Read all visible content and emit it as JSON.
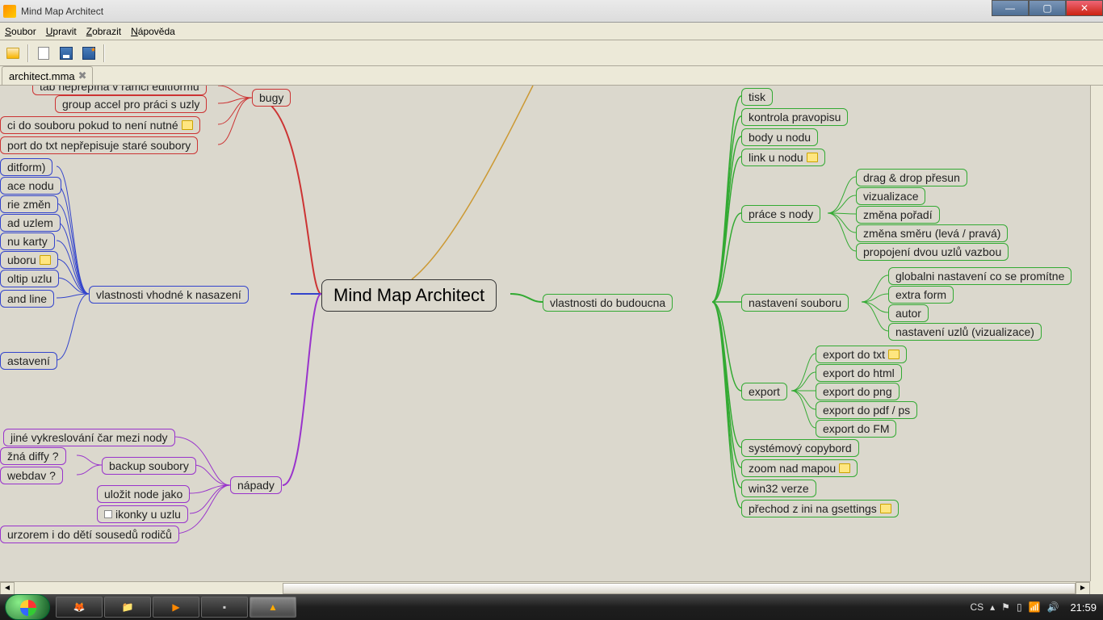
{
  "window": {
    "title": "Mind Map Architect"
  },
  "menu": {
    "file": "Soubor",
    "edit": "Upravit",
    "view": "Zobrazit",
    "help": "Nápověda"
  },
  "tab": {
    "name": "architect.mma"
  },
  "root": {
    "label": "Mind Map Architect"
  },
  "left": {
    "branch1": {
      "label": "bugy",
      "c1": "tab nepřepíná v rámci editformu",
      "c2": "group accel pro práci s uzly",
      "c3": "ci do souboru pokud to není nutné",
      "c4": "port do txt nepřepisuje staré soubory"
    },
    "branch2": {
      "label": "vlastnosti vhodné k nasazení",
      "c1": "ditform)",
      "c2": "ace nodu",
      "c3": "rie změn",
      "c4": "ad uzlem",
      "c5": "nu karty",
      "c6": "uboru",
      "c7": "oltip uzlu",
      "c8": "and line",
      "c9": "astavení"
    },
    "branch3": {
      "label": "nápady",
      "c1": "jiné vykreslování čar mezi nody",
      "c2": "žná diffy ?",
      "c3": "webdav ?",
      "c4": "backup soubory",
      "c5": "uložit node jako",
      "c6": "ikonky u uzlu",
      "c7": "urzorem i do dětí sousedů rodičů"
    }
  },
  "right": {
    "branch": {
      "label": "vlastnosti do budoucna",
      "c1": "tisk",
      "c2": "kontrola pravopisu",
      "c3": "body u nodu",
      "c4": "link u nodu",
      "g1": {
        "label": "práce s nody",
        "c1": "drag & drop přesun",
        "c2": "vizualizace",
        "c3": "změna pořadí",
        "c4": "změna směru (levá / pravá)",
        "c5": "propojení dvou uzlů vazbou"
      },
      "g2": {
        "label": "nastavení souboru",
        "c1": "globalni nastavení co se promítne",
        "c2": "extra form",
        "c3": "autor",
        "c4": "nastavení uzlů (vizualizace)"
      },
      "g3": {
        "label": "export",
        "c1": "export do txt",
        "c2": "export do html",
        "c3": "export do png",
        "c4": "export do pdf / ps",
        "c5": "export do FM"
      },
      "c5": "systémový copybord",
      "c6": "zoom nad mapou",
      "c7": "win32 verze",
      "c8": "přechod z ini na gsettings"
    }
  },
  "tray": {
    "lang": "CS",
    "time": "21:59"
  }
}
